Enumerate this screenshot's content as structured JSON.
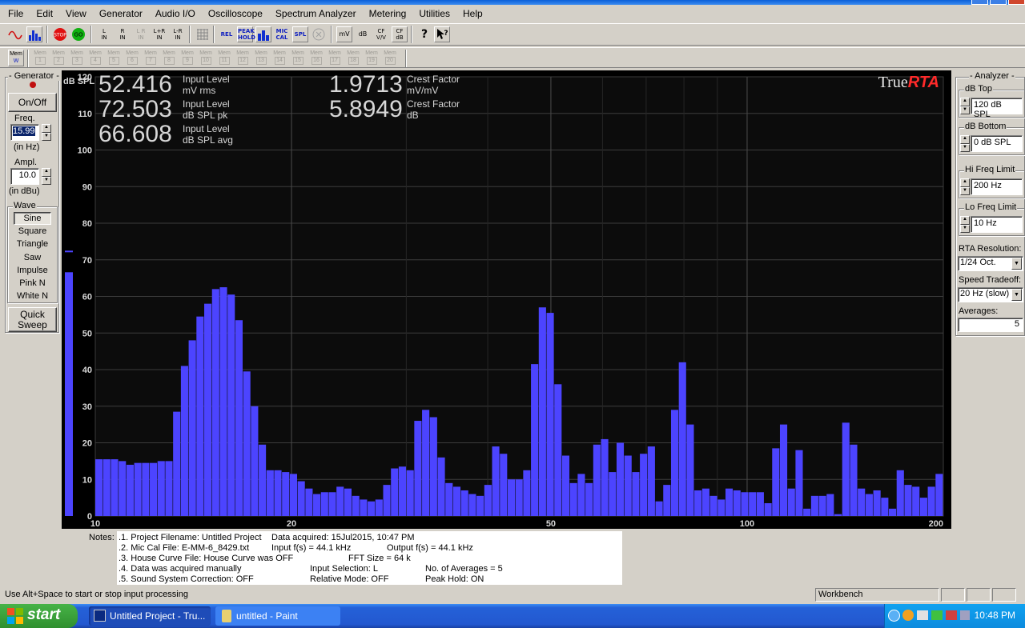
{
  "menu": [
    "File",
    "Edit",
    "View",
    "Generator",
    "Audio I/O",
    "Oscilloscope",
    "Spectrum Analyzer",
    "Metering",
    "Utilities",
    "Help"
  ],
  "toolbar": {
    "l_in": "L\nIN",
    "r_in": "R\nIN",
    "lr_in": "L R\nIN",
    "lplusr_in": "L+R\nIN",
    "lminusr_in": "L-R\nIN",
    "rel": "REL",
    "peak_hold": "PEAK\nHOLD",
    "mic_cal": "MIC\nCAL",
    "spl": "SPL",
    "mv": "mV",
    "db": "dB",
    "cf_vv": "CF\nV/V",
    "cf_db": "CF\ndB",
    "help": "?"
  },
  "mem": {
    "label": "Mem",
    "items": [
      "W",
      "1",
      "2",
      "3",
      "4",
      "5",
      "6",
      "7",
      "8",
      "9",
      "10",
      "11",
      "12",
      "13",
      "14",
      "15",
      "16",
      "17",
      "18",
      "19",
      "20"
    ]
  },
  "generator": {
    "title": "- Generator -",
    "onoff": "On/Off",
    "freq_title": "Freq.",
    "freq_value": "15.99",
    "freq_unit": "(in Hz)",
    "ampl_title": "Ampl.",
    "ampl_value": "10.0",
    "ampl_unit": "(in dBu)",
    "wave_title": "Wave",
    "waves": [
      "Sine",
      "Square",
      "Triangle",
      "Saw",
      "Impulse",
      "Pink N",
      "White N"
    ],
    "quick_sweep": "Quick\nSweep"
  },
  "display": {
    "y_unit": "dB SPL",
    "readouts": [
      {
        "value": "52.416",
        "label1": "Input Level",
        "label2": "mV rms"
      },
      {
        "value": "72.503",
        "label1": "Input Level",
        "label2": "dB SPL pk"
      },
      {
        "value": "66.608",
        "label1": "Input Level",
        "label2": "dB SPL avg"
      },
      {
        "value": "1.9713",
        "label1": "Crest Factor",
        "label2": "mV/mV"
      },
      {
        "value": "5.8949",
        "label1": "Crest Factor",
        "label2": "dB"
      }
    ],
    "logo_true": "True",
    "logo_rta": "RTA",
    "level_meter_value": 66.6,
    "peak_meter_value": 72.5,
    "bar_color": "#4c44ff"
  },
  "chart_data": {
    "type": "bar",
    "title": "",
    "xlabel": "",
    "ylabel": "dB SPL",
    "x_scale": "log",
    "xlim": [
      10,
      200
    ],
    "ylim": [
      0,
      120
    ],
    "x_ticks": [
      10,
      20,
      50,
      100,
      200
    ],
    "y_ticks": [
      0,
      10,
      20,
      30,
      40,
      50,
      60,
      70,
      80,
      90,
      100,
      110,
      120
    ],
    "grid": true,
    "values": [
      15.5,
      15.5,
      15.5,
      15,
      14,
      14.5,
      14.5,
      14.5,
      15,
      15,
      28.5,
      41,
      48,
      54.5,
      58,
      62,
      62.5,
      60.5,
      53.5,
      39.5,
      30,
      19.5,
      12.5,
      12.5,
      12,
      11.5,
      9.5,
      7.5,
      6,
      6.5,
      6.5,
      8,
      7.5,
      5.5,
      4.5,
      4,
      4.5,
      8.5,
      13,
      13.5,
      12.5,
      26,
      29,
      27,
      16,
      9,
      8,
      7,
      6,
      5.5,
      8.5,
      19,
      17,
      10,
      10,
      12.5,
      41.5,
      57,
      55.5,
      36,
      16.5,
      9,
      11.5,
      9,
      19.5,
      21,
      12,
      20,
      16.5,
      12,
      17,
      19,
      4,
      8.5,
      29,
      42,
      25,
      7,
      7.5,
      5.5,
      4.5,
      7.5,
      7,
      6.5,
      6.5,
      6.5,
      3.5,
      18.5,
      25,
      7.5,
      18,
      2,
      5.5,
      5.5,
      6,
      0.5,
      25.5,
      19.5,
      7.5,
      6,
      7,
      5,
      2,
      12.5,
      8.5,
      8,
      5,
      8,
      11.5
    ]
  },
  "analyzer": {
    "title": "- Analyzer -",
    "db_top_title": "dB Top",
    "db_top_value": "120 dB SPL",
    "db_bottom_title": "dB Bottom",
    "db_bottom_value": "0 dB SPL",
    "hi_freq_title": "Hi Freq Limit",
    "hi_freq_value": "200 Hz",
    "lo_freq_title": "Lo Freq Limit",
    "lo_freq_value": "10 Hz",
    "rta_res_title": "RTA Resolution:",
    "rta_res_value": "1/24 Oct.",
    "speed_title": "Speed Tradeoff:",
    "speed_value": "20 Hz (slow)",
    "averages_title": "Averages:",
    "averages_value": "5"
  },
  "notes": {
    "label": "Notes:",
    "lines": [
      ".1. Project Filename: Untitled Project",
      ".2. Mic Cal File: E-MM-6_8429.txt",
      ".3. House Curve File: House Curve was OFF",
      ".4. Data was acquired manually",
      ".5. Sound System Correction: OFF"
    ],
    "col2": [
      "Data acquired: 15Jul2015, 10:47 PM",
      "Input f(s) = 44.1 kHz",
      "FFT Size = 64 k",
      "Input Selection: L",
      "Relative Mode:  OFF"
    ],
    "col3": [
      "Output f(s) = 44.1 kHz",
      "No. of Averages = 5",
      "Peak Hold: ON"
    ]
  },
  "status": {
    "message": "Use Alt+Space to start or stop input processing",
    "mode": "Workbench"
  },
  "taskbar": {
    "start": "start",
    "tasks": [
      "Untitled Project - Tru...",
      "untitled - Paint"
    ],
    "clock": "10:48 PM"
  }
}
